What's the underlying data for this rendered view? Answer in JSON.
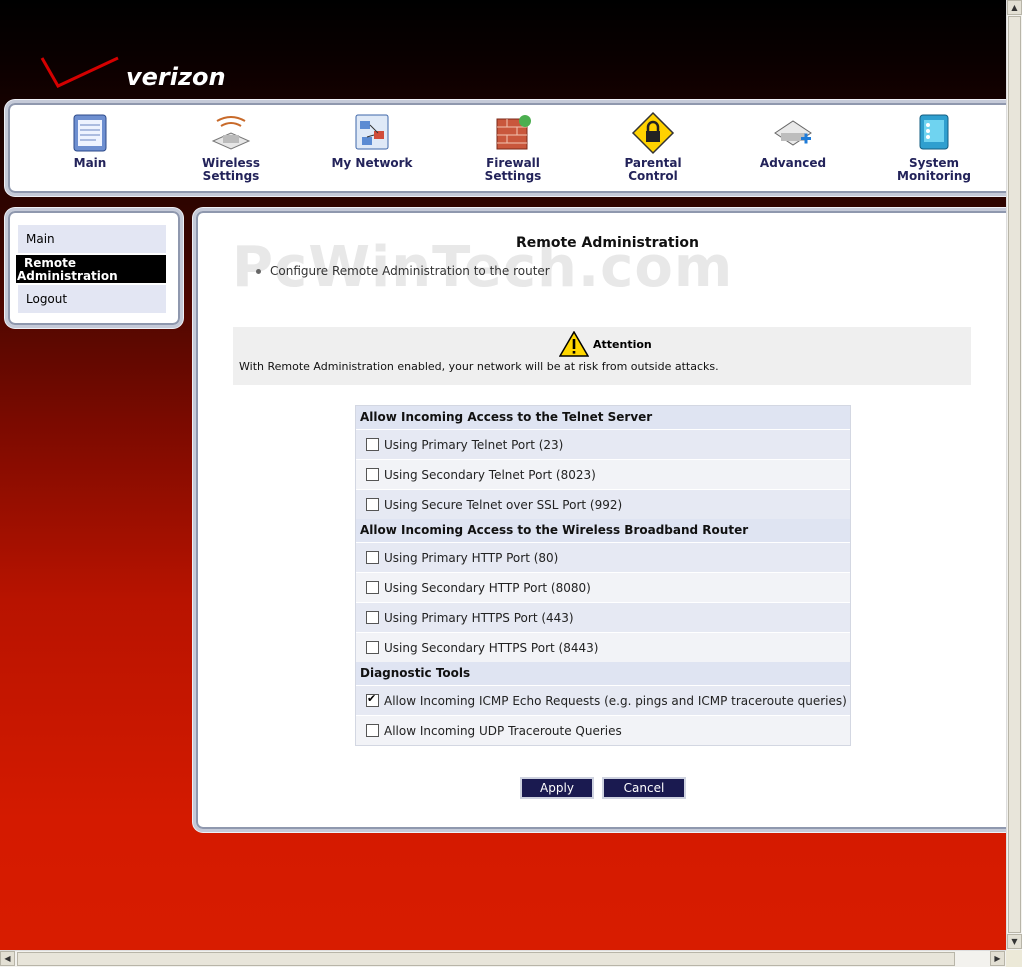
{
  "brand": {
    "logo_text": "verizon"
  },
  "nav": {
    "items": [
      {
        "label_line1": "Main",
        "label_line2": "",
        "icon": "main-icon"
      },
      {
        "label_line1": "Wireless",
        "label_line2": "Settings",
        "icon": "wireless-settings-icon"
      },
      {
        "label_line1": "My Network",
        "label_line2": "",
        "icon": "my-network-icon"
      },
      {
        "label_line1": "Firewall",
        "label_line2": "Settings",
        "icon": "firewall-icon"
      },
      {
        "label_line1": "Parental",
        "label_line2": "Control",
        "icon": "parental-lock-icon"
      },
      {
        "label_line1": "Advanced",
        "label_line2": "",
        "icon": "advanced-icon"
      },
      {
        "label_line1": "System",
        "label_line2": "Monitoring",
        "icon": "system-monitoring-icon"
      }
    ]
  },
  "sidebar": {
    "items": [
      {
        "label": "Main",
        "active": false
      },
      {
        "label_line1": "Remote",
        "label_line2": "Administration",
        "active": true
      },
      {
        "label": "Logout",
        "active": false
      }
    ]
  },
  "watermark": "PcWinTech.com",
  "page": {
    "title": "Remote Administration",
    "description": "Configure Remote Administration to the router"
  },
  "attention": {
    "heading": "Attention",
    "text": "With Remote Administration enabled, your network will be at risk from outside attacks."
  },
  "sections": [
    {
      "title": "Allow Incoming Access to the Telnet Server",
      "options": [
        {
          "label": "Using Primary Telnet Port (23)",
          "checked": false
        },
        {
          "label": "Using Secondary Telnet Port (8023)",
          "checked": false
        },
        {
          "label": "Using Secure Telnet over SSL Port (992)",
          "checked": false
        }
      ]
    },
    {
      "title": "Allow Incoming Access to the Wireless Broadband Router",
      "options": [
        {
          "label": "Using Primary HTTP Port (80)",
          "checked": false
        },
        {
          "label": "Using Secondary HTTP Port (8080)",
          "checked": false
        },
        {
          "label": "Using Primary HTTPS Port (443)",
          "checked": false
        },
        {
          "label": "Using Secondary HTTPS Port (8443)",
          "checked": false
        }
      ]
    },
    {
      "title": "Diagnostic Tools",
      "options": [
        {
          "label": "Allow Incoming ICMP Echo Requests (e.g. pings and ICMP traceroute queries)",
          "checked": true
        },
        {
          "label": "Allow Incoming UDP Traceroute Queries",
          "checked": false
        }
      ]
    }
  ],
  "buttons": {
    "apply": "Apply",
    "cancel": "Cancel"
  },
  "colors": {
    "brand_red": "#d41a00",
    "button_bg": "#1a1a50",
    "section_header_bg": "#dfe4f2"
  }
}
